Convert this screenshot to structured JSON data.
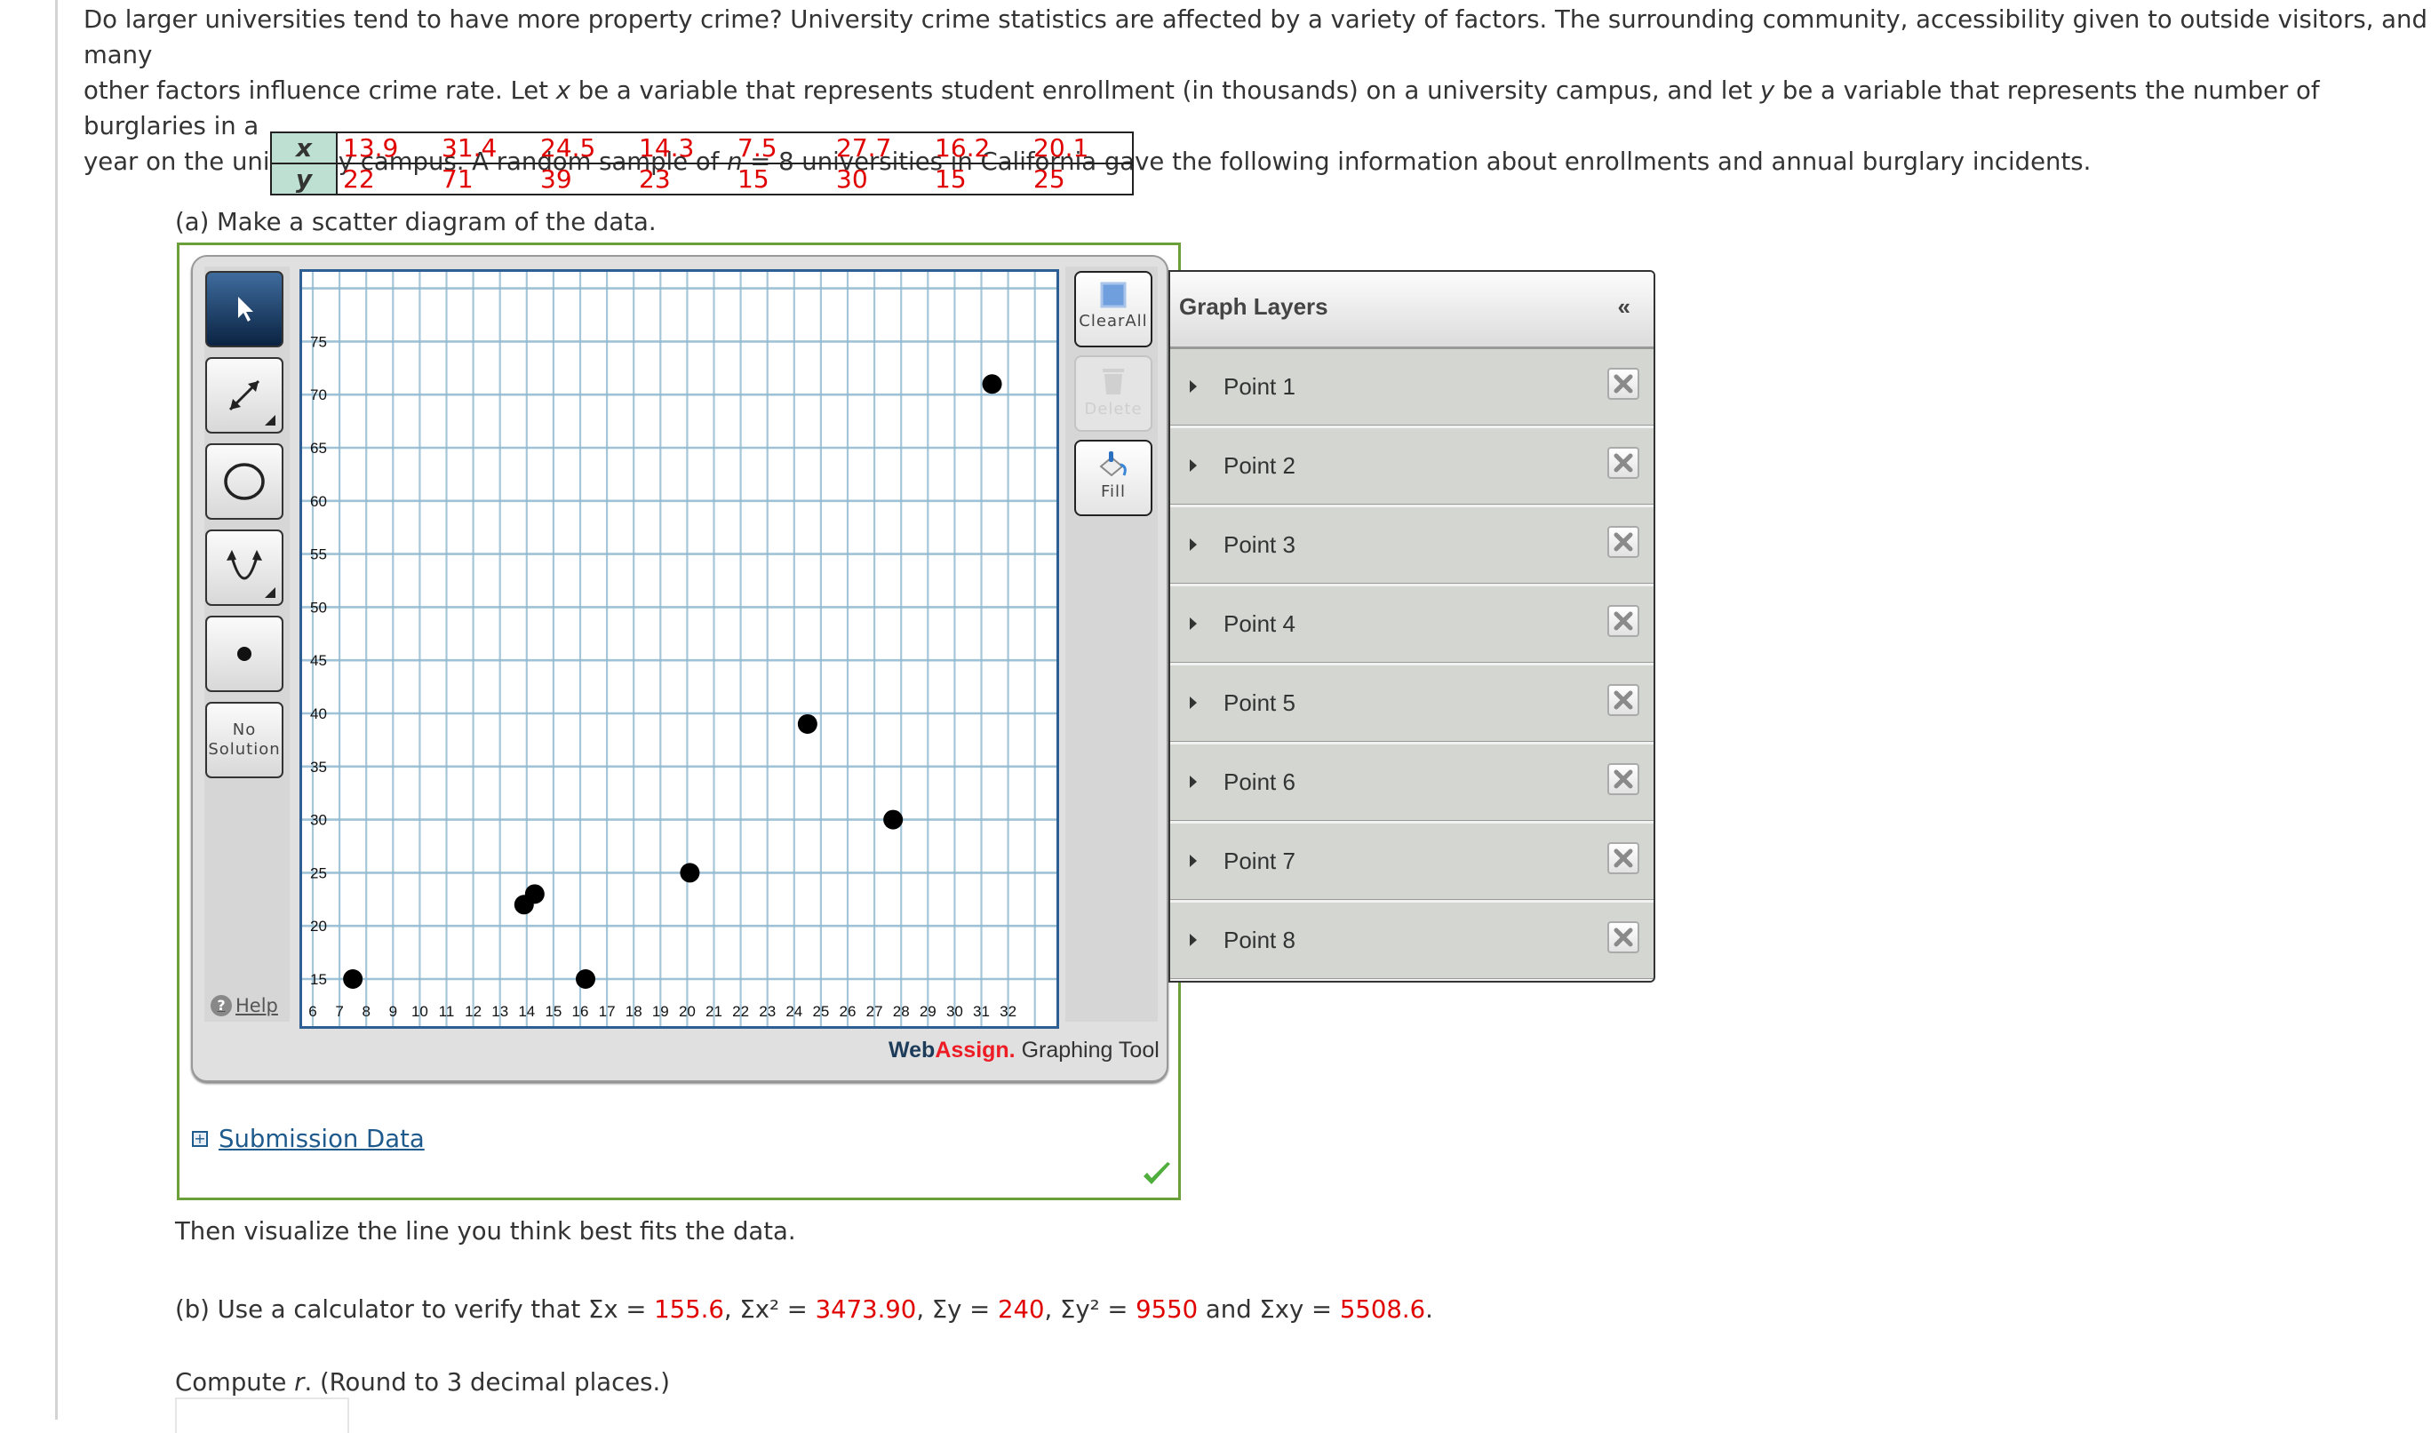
{
  "intro": {
    "line1": "Do larger universities tend to have more property crime? University crime statistics are affected by a variety of factors. The surrounding community, accessibility given to outside visitors, and many",
    "line2a": "other factors influence crime rate. Let ",
    "line2_x": "x",
    "line2b": " be a variable that represents student enrollment (in thousands) on a university campus, and let ",
    "line2_y": "y",
    "line2c": " be a variable that represents the number of burglaries in a",
    "line3a": "year on the university campus. A random sample of ",
    "line3_n": "n",
    "line3b": " = 8 universities in California gave the following information about enrollments and annual burglary incidents."
  },
  "table": {
    "x_label": "x",
    "y_label": "y",
    "x_values": [
      "13.9",
      "31.4",
      "24.5",
      "14.3",
      "7.5",
      "27.7",
      "16.2",
      "20.1"
    ],
    "y_values": [
      "22",
      "71",
      "39",
      "23",
      "15",
      "30",
      "15",
      "25"
    ]
  },
  "part_a": "(a) Make a scatter diagram of the data.",
  "tool": {
    "left_tools": [
      {
        "name": "select-tool",
        "label": ""
      },
      {
        "name": "line-tool",
        "label": ""
      },
      {
        "name": "circle-tool",
        "label": ""
      },
      {
        "name": "parabola-tool",
        "label": ""
      },
      {
        "name": "point-tool",
        "label": ""
      },
      {
        "name": "no-solution-button",
        "label_line1": "No",
        "label_line2": "Solution"
      }
    ],
    "help_label": "Help",
    "clear_all_label": "ClearAll",
    "delete_label": "Delete",
    "fill_label": "Fill",
    "logo_web": "Web",
    "logo_assign": "Assign.",
    "logo_tool": " Graphing Tool",
    "colors": {
      "grid": "#8fb8cf",
      "frame": "#2d5f95",
      "active_tool": "#1b3f66",
      "point": "#000000"
    }
  },
  "layers": {
    "title": "Graph Layers",
    "collapse_glyph": "«",
    "items": [
      {
        "label": "Point 1"
      },
      {
        "label": "Point 2"
      },
      {
        "label": "Point 3"
      },
      {
        "label": "Point 4"
      },
      {
        "label": "Point 5"
      },
      {
        "label": "Point 6"
      },
      {
        "label": "Point 7"
      },
      {
        "label": "Point 8"
      }
    ]
  },
  "chart_data": {
    "type": "scatter",
    "title": "",
    "xlabel": "",
    "ylabel": "",
    "x_ticks": [
      6,
      7,
      8,
      9,
      10,
      11,
      12,
      13,
      14,
      15,
      16,
      17,
      18,
      19,
      20,
      21,
      22,
      23,
      24,
      25,
      26,
      27,
      28,
      29,
      30,
      31,
      32
    ],
    "y_ticks": [
      15,
      20,
      25,
      30,
      35,
      40,
      45,
      50,
      55,
      60,
      65,
      70,
      75
    ],
    "xlim": [
      5.5,
      33.5
    ],
    "ylim": [
      11,
      82
    ],
    "grid": true,
    "points": [
      {
        "x": 13.9,
        "y": 22
      },
      {
        "x": 31.4,
        "y": 71
      },
      {
        "x": 24.5,
        "y": 39
      },
      {
        "x": 14.3,
        "y": 23
      },
      {
        "x": 7.5,
        "y": 15
      },
      {
        "x": 27.7,
        "y": 30
      },
      {
        "x": 16.2,
        "y": 15
      },
      {
        "x": 20.1,
        "y": 25
      }
    ]
  },
  "submission_label": "Submission Data",
  "then_text": "Then visualize the line you think best fits the data.",
  "part_b": {
    "prefix": "(b) Use a calculator to verify that ",
    "sx_label": "Σx = ",
    "sx": "155.6",
    "sx2_label": ", Σx² = ",
    "sx2": "3473.90",
    "sy_label": ", Σy = ",
    "sy": "240",
    "sy2_label": ", Σy² = ",
    "sy2": "9550",
    "sxy_label": " and Σxy = ",
    "sxy": "5508.6",
    "suffix": "."
  },
  "compute_r": {
    "a": "Compute ",
    "r": "r",
    "b": ". (Round to 3 decimal places.)"
  },
  "answer_value": ""
}
